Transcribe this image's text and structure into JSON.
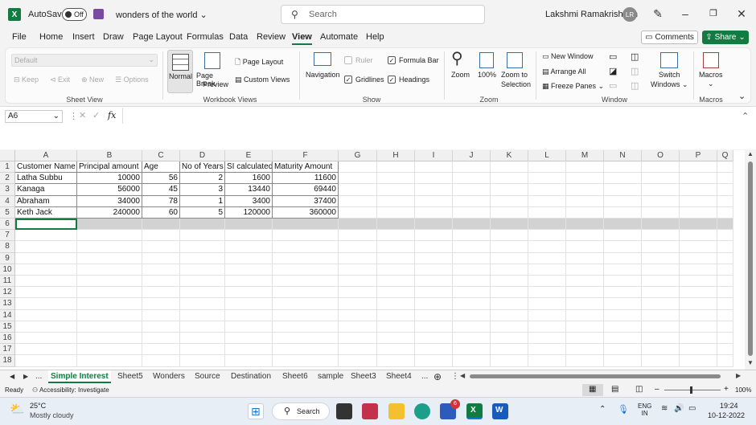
{
  "titlebar": {
    "app_logo": "X",
    "autosave_label": "AutoSave",
    "autosave_state": "Off",
    "doc_title": "wonders of the world",
    "search_placeholder": "Search",
    "user_name": "Lakshmi Ramakrishnan",
    "user_initials": "LR"
  },
  "menu": [
    "File",
    "Home",
    "Insert",
    "Draw",
    "Page Layout",
    "Formulas",
    "Data",
    "Review",
    "View",
    "Automate",
    "Help"
  ],
  "menu_active": "View",
  "comments_label": "Comments",
  "share_label": "Share",
  "ribbon": {
    "sheet_view": {
      "dropdown_value": "Default",
      "keep": "Keep",
      "exit": "Exit",
      "new": "New",
      "options": "Options",
      "group": "Sheet View"
    },
    "workbook_views": {
      "normal": "Normal",
      "page_break_1": "Page Break",
      "page_break_2": "Preview",
      "page_layout": "Page Layout",
      "custom_views": "Custom Views",
      "group": "Workbook Views"
    },
    "show": {
      "navigation": "Navigation",
      "ruler": "Ruler",
      "formula_bar": "Formula Bar",
      "gridlines": "Gridlines",
      "headings": "Headings",
      "group": "Show"
    },
    "zoom": {
      "zoom": "Zoom",
      "hundred": "100%",
      "zoom_sel_1": "Zoom to",
      "zoom_sel_2": "Selection",
      "group": "Zoom"
    },
    "window": {
      "new_window": "New Window",
      "arrange_all": "Arrange All",
      "freeze_panes": "Freeze Panes",
      "switch_1": "Switch",
      "switch_2": "Windows",
      "group": "Window"
    },
    "macros": {
      "label": "Macros",
      "group": "Macros"
    }
  },
  "formula_bar": {
    "name_box": "A6",
    "fx": "fx",
    "content": ""
  },
  "columns": [
    "A",
    "B",
    "C",
    "D",
    "E",
    "F",
    "G",
    "H",
    "I",
    "J",
    "K",
    "L",
    "M",
    "N",
    "O",
    "P",
    "Q"
  ],
  "rows": [
    "1",
    "2",
    "3",
    "4",
    "5",
    "6",
    "7",
    "8",
    "9",
    "10",
    "11",
    "12",
    "13",
    "14",
    "15",
    "16",
    "17",
    "18"
  ],
  "table": {
    "headers": [
      "Customer Name",
      "Principal amount",
      "Age",
      "No of Years",
      "SI calculated",
      "Maturity Amount"
    ],
    "rows": [
      [
        "Latha Subbu",
        "10000",
        "56",
        "2",
        "1600",
        "11600"
      ],
      [
        "Kanaga",
        "56000",
        "45",
        "3",
        "13440",
        "69440"
      ],
      [
        "Abraham",
        "34000",
        "78",
        "1",
        "3400",
        "37400"
      ],
      [
        "Keth Jack",
        "240000",
        "60",
        "5",
        "120000",
        "360000"
      ]
    ]
  },
  "sheets": [
    "Simple Interest",
    "Sheet5",
    "Wonders",
    "Source",
    "Destination",
    "Sheet6",
    "sample",
    "Sheet3",
    "Sheet4"
  ],
  "sheet_nav_ellipsis": "...",
  "status": {
    "ready": "Ready",
    "accessibility": "Accessibility: Investigate",
    "zoom": "100%"
  },
  "taskbar": {
    "weather_temp": "25°C",
    "weather_desc": "Mostly cloudy",
    "search": "Search",
    "lang_1": "ENG",
    "lang_2": "IN",
    "time": "19:24",
    "date": "10-12-2022",
    "badge": "6"
  },
  "colors": {
    "excel_green": "#107c41",
    "accent": "#217346"
  }
}
